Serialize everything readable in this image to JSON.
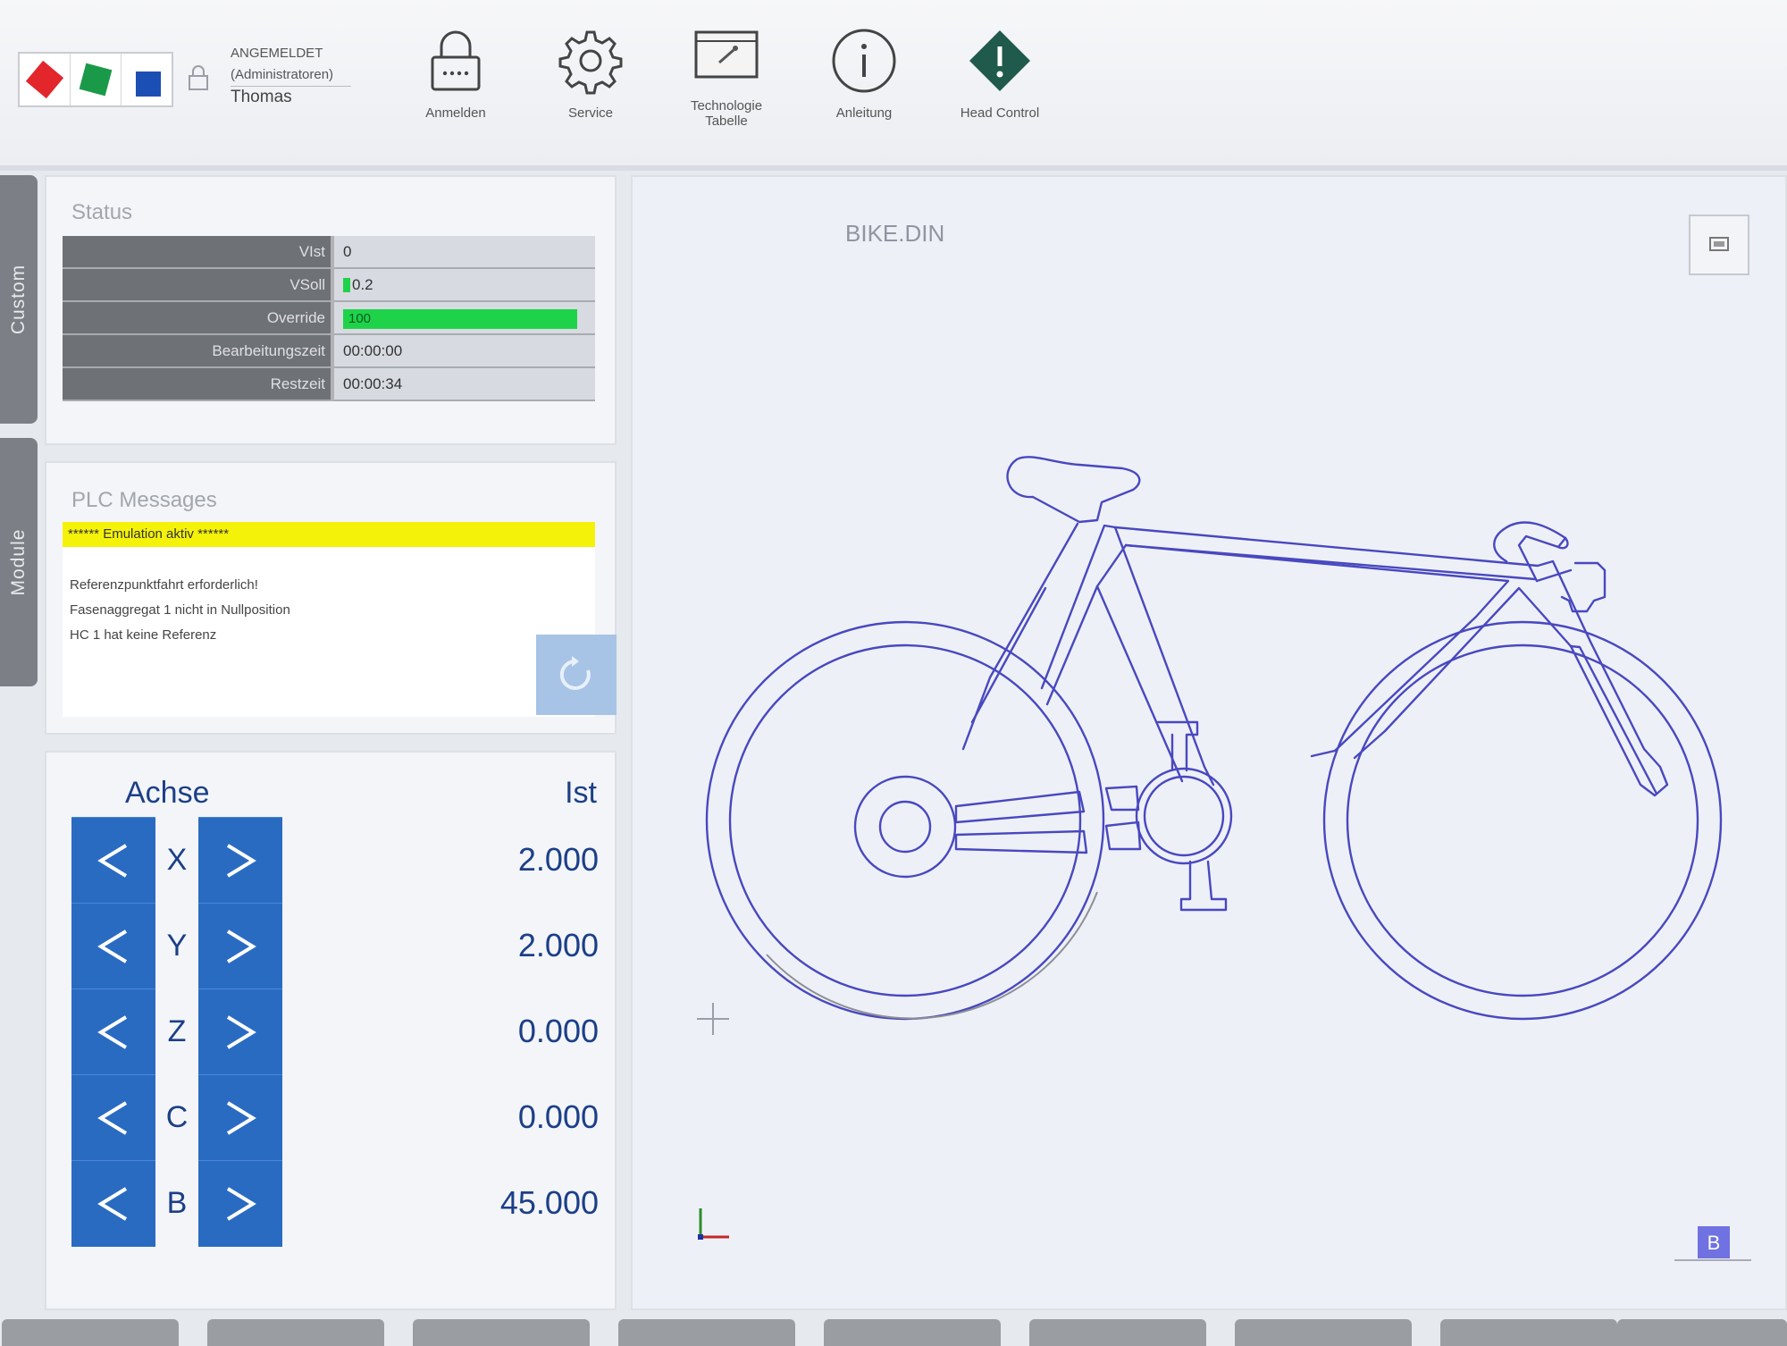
{
  "header": {
    "user_status": "ANGEMELDET",
    "user_role": "(Administratoren)",
    "user_name": "Thomas",
    "tools": [
      {
        "label": "Anmelden",
        "icon": "lock-icon"
      },
      {
        "label": "Service",
        "icon": "gear-icon"
      },
      {
        "label": "Technologie Tabelle",
        "icon": "technology-table-icon"
      },
      {
        "label": "Anleitung",
        "icon": "info-icon"
      },
      {
        "label": "Head Control",
        "icon": "head-control-warning-icon"
      }
    ]
  },
  "side_tabs": [
    "Custom",
    "Module"
  ],
  "status": {
    "title": "Status",
    "rows": [
      {
        "label": "VIst",
        "value": "0"
      },
      {
        "label": "VSoll",
        "value": "0.2"
      },
      {
        "label": "Override",
        "value": "100",
        "fill": 1.0
      },
      {
        "label": "Bearbeitungszeit",
        "value": "00:00:00"
      },
      {
        "label": "Restzeit",
        "value": "00:00:34"
      }
    ]
  },
  "plc": {
    "title": "PLC Messages",
    "alert": "****** Emulation aktiv ******",
    "messages": [
      "Referenzpunktfahrt erforderlich!",
      "Fasenaggregat 1 nicht in Nullposition",
      "HC 1 hat keine Referenz"
    ],
    "ack_icon": "refresh-icon"
  },
  "axes": {
    "title": "Achse",
    "value_header": "Ist",
    "rows": [
      {
        "name": "X",
        "value": "2.000"
      },
      {
        "name": "Y",
        "value": "2.000"
      },
      {
        "name": "Z",
        "value": "0.000"
      },
      {
        "name": "C",
        "value": "0.000"
      },
      {
        "name": "B",
        "value": "45.000"
      }
    ]
  },
  "preview": {
    "file_name": "BIKE.DIN",
    "view_label": "B"
  },
  "colors": {
    "accent_blue": "#2a6bc2",
    "axis_text": "#1c3f87",
    "override_green": "#1ed34a",
    "alert_yellow": "#f5f20a",
    "bike_stroke": "#4848c0"
  }
}
